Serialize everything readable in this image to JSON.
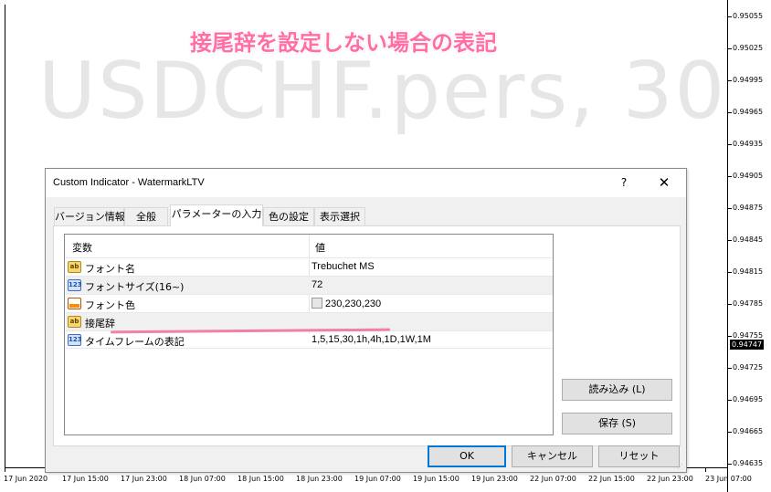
{
  "caption": "接尾辞を設定しない場合の表記",
  "watermark": "USDCHF.pers, 30",
  "price_axis": {
    "labels": [
      "0.95055",
      "0.95025",
      "0.94995",
      "0.94965",
      "0.94935",
      "0.94905",
      "0.94875",
      "0.94845",
      "0.94815",
      "0.94785",
      "0.94755",
      "0.94725",
      "0.94695",
      "0.94665",
      "0.94635"
    ],
    "current": "0.94747"
  },
  "time_axis": {
    "labels": [
      "17 Jun 2020",
      "17 Jun 15:00",
      "17 Jun 23:00",
      "18 Jun 07:00",
      "18 Jun 15:00",
      "18 Jun 23:00",
      "19 Jun 07:00",
      "19 Jun 15:00",
      "19 Jun 23:00",
      "22 Jun 07:00",
      "22 Jun 15:00",
      "22 Jun 23:00",
      "23 Jun 07:00"
    ]
  },
  "dialog": {
    "title": "Custom Indicator - WatermarkLTV",
    "help": "?",
    "close": "✕",
    "tabs": [
      "バージョン情報",
      "全般",
      "パラメーターの入力",
      "色の設定",
      "表示選択"
    ],
    "active_tab": "パラメーターの入力",
    "table": {
      "headers": [
        "変数",
        "値"
      ],
      "rows": [
        {
          "icon": "ab-string-icon",
          "name": "フォント名",
          "value": "Trebuchet MS"
        },
        {
          "icon": "123-number-icon",
          "name": "フォントサイズ(16~)",
          "value": "72"
        },
        {
          "icon": "color-icon",
          "name": "フォント色",
          "value": "230,230,230",
          "swatch_color": "#e6e6e6"
        },
        {
          "icon": "ab-string-icon",
          "name": "接尾辞",
          "value": ""
        },
        {
          "icon": "123-number-icon",
          "name": "タイムフレームの表記",
          "value": "1,5,15,30,1h,4h,1D,1W,1M"
        }
      ]
    },
    "buttons": {
      "load": "読み込み (L)",
      "save": "保存 (S)",
      "ok": "OK",
      "cancel": "キャンセル",
      "reset": "リセット"
    },
    "highlight_color": "#f06b9e"
  }
}
